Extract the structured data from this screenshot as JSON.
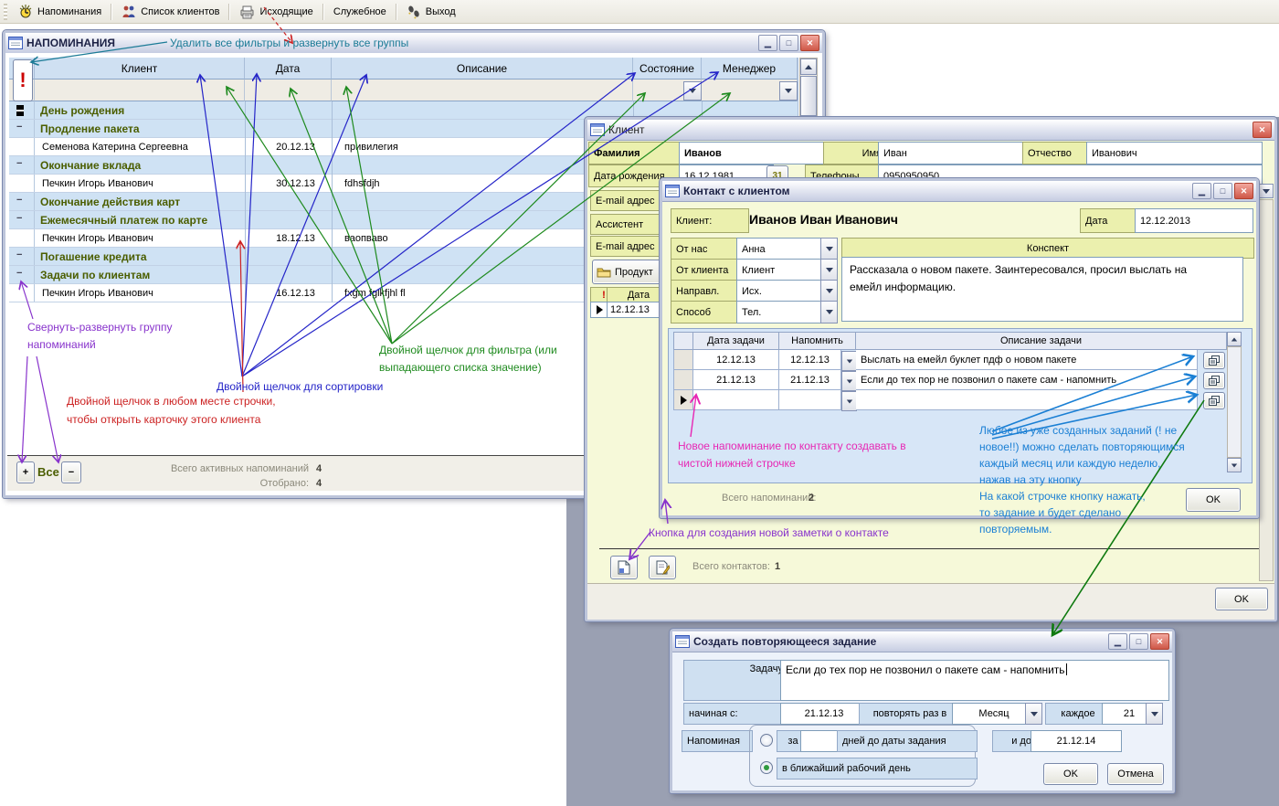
{
  "menu": {
    "items": [
      {
        "label": "Напоминания"
      },
      {
        "label": "Список клиентов"
      },
      {
        "label": "Исходящие"
      },
      {
        "label": "Служебное"
      },
      {
        "label": "Выход"
      }
    ]
  },
  "reminders": {
    "title": "НАПОМИНАНИЯ",
    "columns": [
      "Клиент",
      "Дата",
      "Описание",
      "Состояние",
      "Менеджер"
    ],
    "group_marker": "−",
    "rows": [
      {
        "type": "group",
        "label": "День рождения"
      },
      {
        "type": "group",
        "label": "Продление пакета"
      },
      {
        "type": "item",
        "client": "Семенова Катерина Сергеевна",
        "date": "20.12.13",
        "desc": "привилегия"
      },
      {
        "type": "group",
        "label": "Окончание вклада"
      },
      {
        "type": "item",
        "client": "Печкин Игорь Иванович",
        "date": "30.12.13",
        "desc": "fdhsfdjh"
      },
      {
        "type": "group",
        "label": "Окончание действия карт"
      },
      {
        "type": "group",
        "label": "Ежемесячный платеж по карте"
      },
      {
        "type": "item",
        "client": "Печкин Игорь Иванович",
        "date": "18.12.13",
        "desc": "ваопваво"
      },
      {
        "type": "group",
        "label": "Погашение кредита"
      },
      {
        "type": "group",
        "label": "Задачи по клиентам"
      },
      {
        "type": "item",
        "client": "Печкин Игорь Иванович",
        "date": "16.12.13",
        "desc": "fxgm fglkfjhl fl"
      }
    ],
    "footer": {
      "plus_label": "+",
      "all_label": "Все",
      "minus_label": "−",
      "total_label": "Всего активных напоминаний",
      "total_value": "4",
      "selected_label": "Отобрано:",
      "selected_value": "4"
    }
  },
  "client": {
    "title": "Клиент",
    "surname_label": "Фамилия",
    "surname": "Иванов",
    "name_label": "Имя",
    "name": "Иван",
    "patronymic_label": "Отчество",
    "patronymic": "Иванович",
    "birth_label": "Дата рождения",
    "birth": "16.12.1981",
    "calendar_button": "31",
    "phones_label": "Телефоны",
    "phones": "0950950950",
    "email_label": "E-mail адрес",
    "assistant_label": "Ассистент",
    "email2_label": "E-mail адрес",
    "product_button": "Продукт",
    "mini_table": {
      "alert": "!",
      "date_header": "Дата",
      "date_value": "12.12.13"
    },
    "contacts_total_label": "Всего контактов:",
    "contacts_total": "1",
    "ok": "OK"
  },
  "contact": {
    "title": "Контакт с клиентом",
    "client_label": "Клиент:",
    "client_name": "Иванов Иван Иванович",
    "date_label": "Дата",
    "date": "12.12.2013",
    "from_us_label": "От нас",
    "from_us": "Анна",
    "from_client_label": "От клиента",
    "from_client": "Клиент",
    "direction_label": "Направл.",
    "direction": "Исх.",
    "method_label": "Способ",
    "method": "Тел.",
    "summary_header": "Конспект",
    "summary": "Рассказала о новом пакете. Заинтересовался, просил выслать на емейл информацию.",
    "task_columns": [
      "Дата задачи",
      "Напомнить",
      "Описание задачи"
    ],
    "tasks": [
      {
        "date": "12.12.13",
        "remind": "12.12.13",
        "desc": "Выслать на емейл буклет пдф о новом пакете"
      },
      {
        "date": "21.12.13",
        "remind": "21.12.13",
        "desc": "Если до тех пор не позвонил о пакете сам - напомнить"
      },
      {
        "date": "",
        "remind": "",
        "desc": ""
      }
    ],
    "reminders_total_label": "Всего напоминаний:",
    "reminders_total": "2",
    "ok": "OK"
  },
  "recurring": {
    "title": "Создать повторяющееся задание",
    "task_label": "Задачу:",
    "task": "Если до тех пор не позвонил о пакете сам - напомнить",
    "start_label": "начиная с:",
    "start": "21.12.13",
    "repeat_label": "повторять раз в",
    "repeat": "Месяц",
    "every_label": "каждое",
    "every": "21",
    "remind_label": "Напоминая",
    "opt_days_prefix": "за",
    "opt_days_suffix": "дней до даты задания",
    "opt_workday": "в ближайший рабочий день",
    "until_label": "и до:",
    "until": "21.12.14",
    "ok": "OK",
    "cancel": "Отмена"
  },
  "annotations": {
    "clear_filters": "Удалить все фильтры и развернуть все группы",
    "collapse_1": "Свернуть-развернуть группу",
    "collapse_2": "напоминаний",
    "sort": "Двойной щелчок для сортировки",
    "filter_1": "Двойной щелчок для фильтра (или",
    "filter_2": "выпадающего списка значение)",
    "row_click_1": "Двойной щелчок в любом месте строчки,",
    "row_click_2": "чтобы открыть карточку этого клиента",
    "new_reminder_1": "Новое напоминание по контакту создавать в",
    "new_reminder_2": "чистой нижней строчке",
    "repeat_1": "Любое из уже созданных заданий (! не",
    "repeat_2": "новое!!) можно сделать повторяющимся",
    "repeat_3": "каждый месяц или каждую неделю,",
    "repeat_4": "нажав на эту кнопку",
    "repeat_5": "На какой строчке кнопку нажать,",
    "repeat_6": "то задание и будет сделано",
    "repeat_7": "повторяемым.",
    "new_note": "Кнопка для создания новой заметки о контакте"
  },
  "colors": {
    "annotation_teal": "#1b7b96",
    "annotation_blue": "#2525c8",
    "annotation_green": "#1e8a1e",
    "annotation_red": "#cc2222",
    "annotation_purple": "#8833cc",
    "annotation_magenta": "#e727b4",
    "annotation_cyan": "#1a7fd4",
    "annotation_dark_green": "#0f7a0f",
    "group_text": "#4b5e00",
    "client_body": "#f6f9d9",
    "label_bg": "#ebf0ae",
    "backdrop": "#9aa0b2"
  }
}
